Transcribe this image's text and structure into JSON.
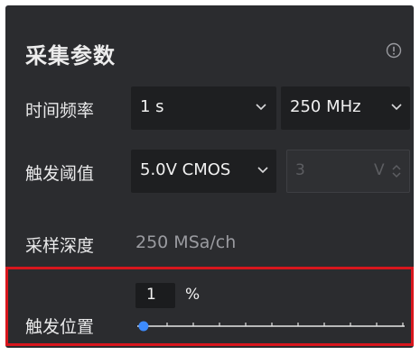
{
  "panel": {
    "title": "采集参数",
    "info_icon": "info-circle-icon"
  },
  "rows": {
    "time_freq": {
      "label": "时间频率",
      "time_value": "1 s",
      "freq_value": "250 MHz"
    },
    "trigger_threshold": {
      "label": "触发阈值",
      "level_value": "5.0V CMOS",
      "custom_value": "3",
      "custom_unit": "V"
    },
    "sample_depth": {
      "label": "采样深度",
      "value": "250 MSa/ch"
    },
    "trigger_position": {
      "label": "触发位置",
      "value": "1",
      "unit": "%",
      "slider_percent": 1
    }
  },
  "colors": {
    "panel_bg": "#2b2c2f",
    "input_bg": "#1e1f21",
    "accent": "#3d8bfd",
    "highlight": "#d8161d"
  }
}
